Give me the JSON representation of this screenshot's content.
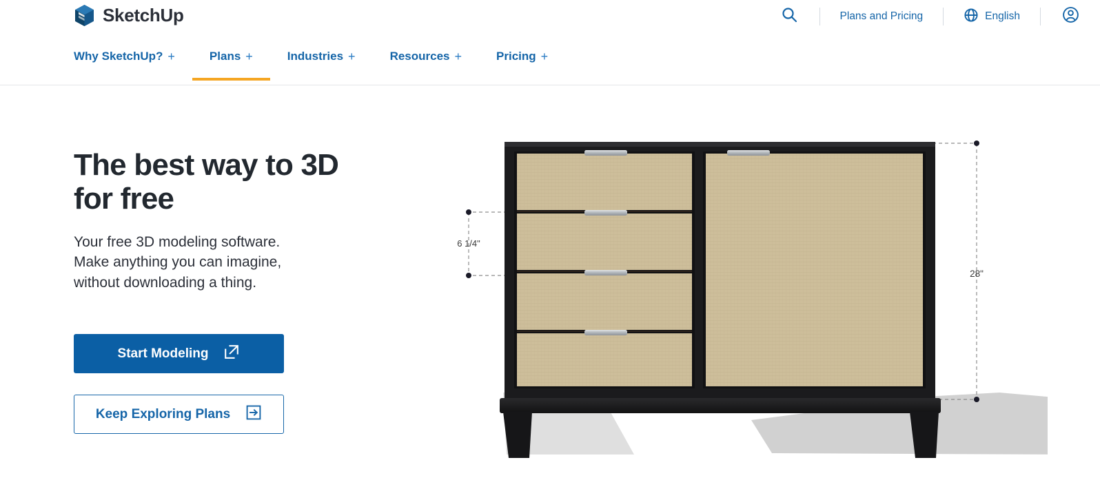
{
  "brand": {
    "name": "SketchUp",
    "logo_icon": "sketchup-logo-icon"
  },
  "utility": {
    "search_icon": "search-icon",
    "plans_and_pricing": "Plans and Pricing",
    "globe_icon": "globe-icon",
    "language": "English",
    "account_icon": "account-icon"
  },
  "nav": {
    "items": [
      {
        "label": "Why SketchUp?",
        "plus": "+",
        "active": false
      },
      {
        "label": "Plans",
        "plus": "+",
        "active": true
      },
      {
        "label": "Industries",
        "plus": "+",
        "active": false
      },
      {
        "label": "Resources",
        "plus": "+",
        "active": false
      },
      {
        "label": "Pricing",
        "plus": "+",
        "active": false
      }
    ],
    "active_underline_color": "#f5a623"
  },
  "hero": {
    "title_line1": "The best way to 3D",
    "title_line2": "for free",
    "sub_line1": "Your free 3D modeling software.",
    "sub_line2": "Make anything you can imagine,",
    "sub_line3": "without downloading a thing.",
    "primary_button": {
      "label": "Start Modeling",
      "icon": "external-link-icon"
    },
    "secondary_button": {
      "label": "Keep Exploring Plans",
      "icon": "arrow-right-box-icon"
    }
  },
  "model": {
    "alt": "3D model of a black sideboard cabinet with four woven drawers and a cabinet door",
    "dimension_left": "6 1/4\"",
    "dimension_right": "28\"",
    "frame_color": "#1b1b1d",
    "panel_color": "#cdbe9a",
    "handle_color": "#b8bcc0",
    "shadow_color": "#c9c9c9"
  },
  "colors": {
    "link_blue": "#1565a8",
    "primary_blue": "#0b5fa5",
    "accent_orange": "#f5a623",
    "heading_dark": "#22282f"
  }
}
